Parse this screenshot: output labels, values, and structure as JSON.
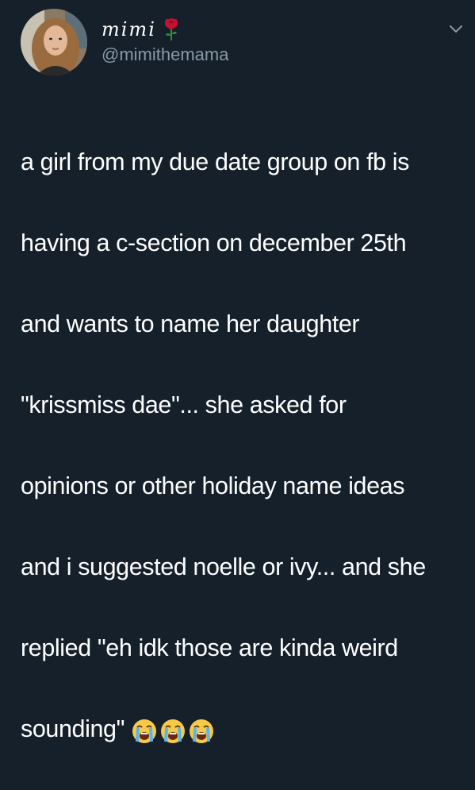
{
  "tweet": {
    "display_name": "mimi",
    "display_name_emoji": "rose-icon",
    "handle": "@mimithemama",
    "menu_icon": "chevron-down-icon",
    "text_lines": [
      "a girl from my due date group on fb is",
      "having a c-section on december 25th",
      "and wants to name her daughter",
      "\"krissmiss dae\"... she asked for",
      "opinions or other holiday name ideas",
      "and i suggested noelle or ivy... and she",
      "replied \"eh idk those are kinda weird",
      "sounding\""
    ],
    "trailing_emojis": [
      "loudly-crying-face-icon",
      "loudly-crying-face-icon",
      "loudly-crying-face-icon"
    ]
  },
  "colors": {
    "background": "#15202b",
    "text": "#ffffff",
    "secondary_text": "#8899a6"
  }
}
